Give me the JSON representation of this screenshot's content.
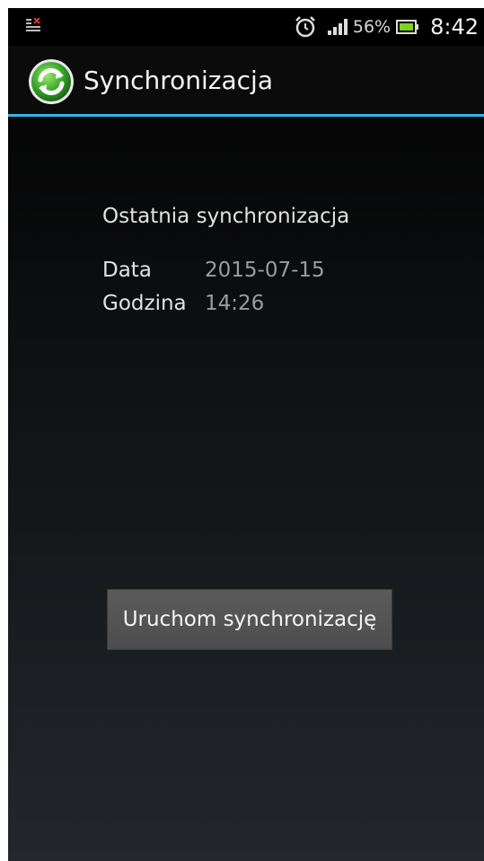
{
  "status_bar": {
    "battery_percent": "56%",
    "time": "8:42",
    "icons": [
      "notification-icon",
      "alarm-icon",
      "signal-icon",
      "battery-icon"
    ]
  },
  "action_bar": {
    "title": "Synchronizacja",
    "icon": "sync-app-icon",
    "accent_color": "#33b5e5"
  },
  "last_sync": {
    "heading": "Ostatnia synchronizacja",
    "date_label": "Data",
    "date_value": "2015-07-15",
    "time_label": "Godzina",
    "time_value": "14:26"
  },
  "actions": {
    "sync_button_label": "Uruchom synchronizację"
  }
}
